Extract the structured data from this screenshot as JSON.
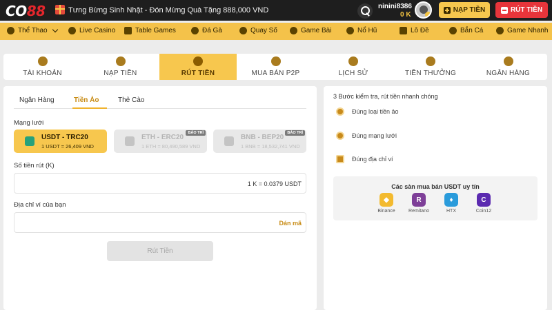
{
  "header": {
    "logo_co": "CO",
    "logo_num": "88",
    "promo": "Tưng Bừng Sinh Nhật - Đón Mừng Quà Tặng 888,000 VND",
    "username": "ninini8386",
    "balance": "0 K",
    "deposit_label": "NẠP TIỀN",
    "withdraw_label": "RÚT TIỀN"
  },
  "nav": {
    "items": [
      {
        "label": "Thể Thao"
      },
      {
        "label": "Live Casino"
      },
      {
        "label": "Table Games"
      },
      {
        "label": "Đá Gà"
      },
      {
        "label": "Quay Số"
      },
      {
        "label": "Game Bài"
      },
      {
        "label": "Nổ Hũ"
      },
      {
        "label": "Lô Đề"
      },
      {
        "label": "Bắn Cá"
      },
      {
        "label": "Game Nhanh"
      }
    ]
  },
  "main_tabs": [
    {
      "label": "TÀI KHOẢN"
    },
    {
      "label": "NẠP TIỀN"
    },
    {
      "label": "RÚT TIỀN",
      "active": true
    },
    {
      "label": "MUA BÁN P2P"
    },
    {
      "label": "LỊCH SỬ"
    },
    {
      "label": "TIỀN THƯỞNG"
    },
    {
      "label": "NGÂN HÀNG"
    }
  ],
  "withdraw": {
    "subtabs": [
      {
        "label": "Ngân Hàng"
      },
      {
        "label": "Tiền Ảo",
        "active": true
      },
      {
        "label": "Thẻ Cào"
      }
    ],
    "network_label": "Mạng lưới",
    "networks": [
      {
        "name": "USDT - TRC20",
        "rate": "1 USDT = 26,409 VND",
        "selected": true,
        "maintenance": ""
      },
      {
        "name": "ETH - ERC20",
        "rate": "1 ETH = 80,490,589 VND",
        "selected": false,
        "maintenance": "BẢO TRÌ"
      },
      {
        "name": "BNB - BEP20",
        "rate": "1 BNB = 18,532,741 VND",
        "selected": false,
        "maintenance": "BẢO TRÌ"
      }
    ],
    "amount_label": "Số tiền rút (K)",
    "amount_value": "",
    "amount_conversion": "1 K = 0.0379 USDT",
    "address_label": "Địa chỉ ví của bạn",
    "address_value": "",
    "paste_label": "Dán mã",
    "submit_label": "Rút Tiền"
  },
  "tips": {
    "title": "3 Bước kiểm tra, rút tiền nhanh chóng",
    "steps": [
      {
        "label": "Đúng loại tiền ảo"
      },
      {
        "label": "Đúng mạng lưới"
      },
      {
        "label": "Đúng địa chỉ ví"
      }
    ],
    "exchanges_title": "Các sàn mua bán USDT uy tín",
    "exchanges": [
      {
        "name": "Binance",
        "color": "#f3ba2f"
      },
      {
        "name": "Remitano",
        "color": "#7e3f98"
      },
      {
        "name": "HTX",
        "color": "#2a9bdb"
      },
      {
        "name": "Coin12",
        "color": "#5b2ab0"
      }
    ]
  },
  "colors": {
    "accent": "#f7c74e",
    "danger": "#e8353b",
    "topbar": "#1e1e1e",
    "tether": "#26a17b"
  }
}
